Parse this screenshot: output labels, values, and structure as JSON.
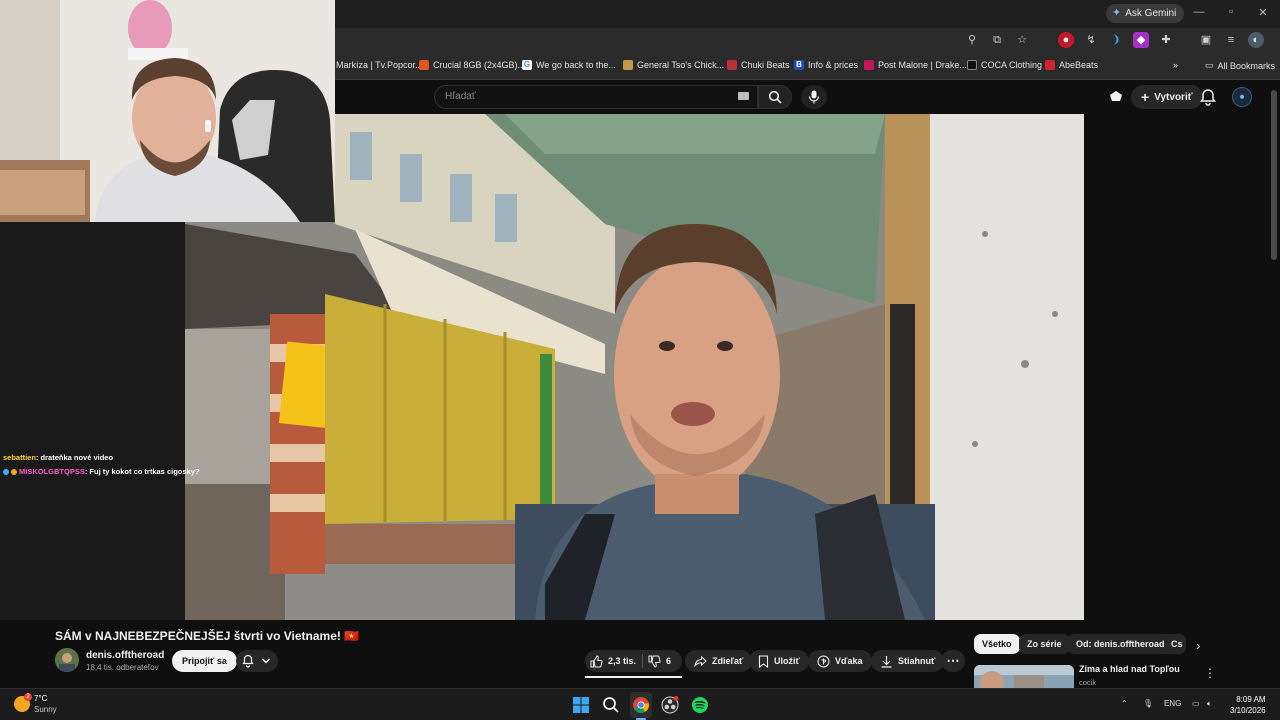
{
  "browser": {
    "ask_gemini": "Ask Gemini",
    "bookmarks": [
      "Markíza | Tv.Popcor...",
      "Crucial 8GB (2x4GB)...",
      "We go back to the...",
      "General Tso's Chick...",
      "Chuki Beats",
      "Info & prices",
      "Post Malone | Drake...",
      "COCA Clothing",
      "AbeBeats"
    ],
    "all_bookmarks": "All Bookmarks"
  },
  "youtube": {
    "search_placeholder": "Hľadať",
    "create_label": "Vytvoriť",
    "video_title": "SÁM v NAJNEBEZPEČNEJŠEJ štvrti vo Vietname! 🇻🇳",
    "channel_name": "denis.offtheroad",
    "subscribers": "18,4 tis. odberateľov",
    "join_label": "Pripojiť sa",
    "likes": "2,3 tis.",
    "dislikes": "6",
    "share_label": "Zdieľať",
    "save_label": "Uložiť",
    "thanks_label": "Vďaka",
    "download_label": "Stiahnuť",
    "chips": [
      "Všetko",
      "Zo série",
      "Od: denis.offtheroad",
      "Cs"
    ],
    "recommended": {
      "title": "Zima a hlad nad Topľou",
      "channel": "cocik"
    }
  },
  "chat": {
    "messages": [
      {
        "user": "sebattien",
        "text": ": drateňka nové video"
      },
      {
        "user": "MISKOLGBTQPSS",
        "text": ": Fuj ty kokot co trtkas cigosky?"
      }
    ]
  },
  "taskbar": {
    "weather_badge": "2",
    "temperature": "7°C",
    "condition": "Sunny",
    "language": "ENG",
    "time": "8:09 AM",
    "date": "3/10/2026"
  }
}
